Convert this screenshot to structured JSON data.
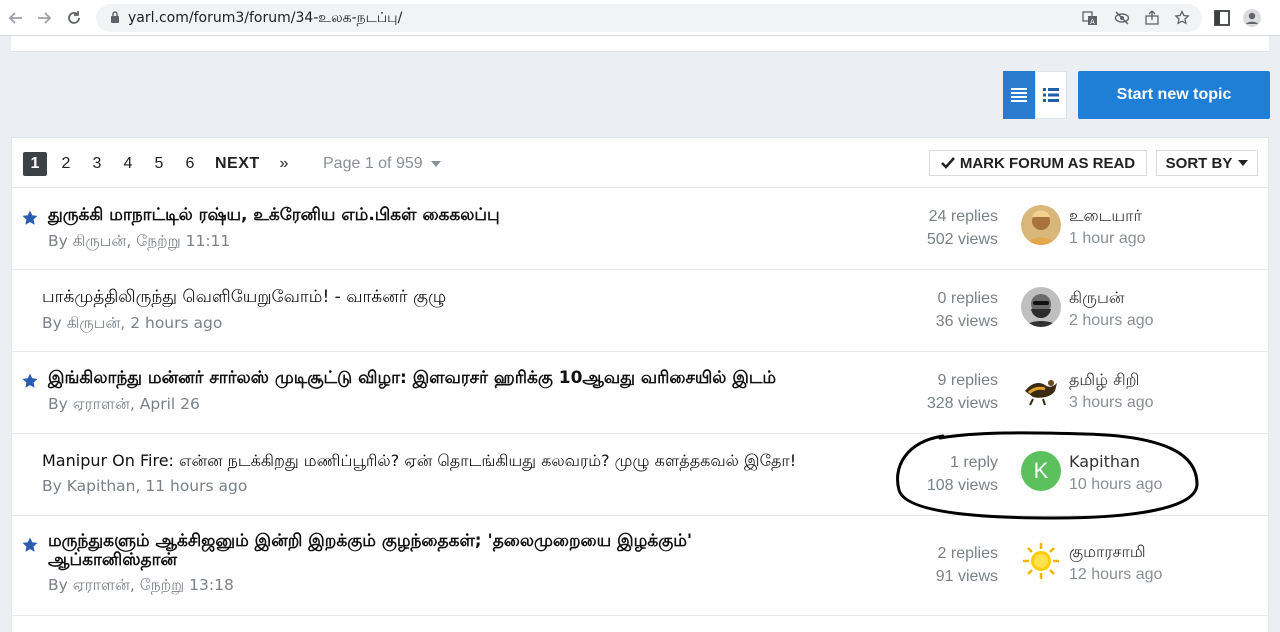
{
  "browser": {
    "url": "yarl.com/forum3/forum/34-உலக-நடப்பு/"
  },
  "toolbar": {
    "start_topic": "Start new topic"
  },
  "pagination": {
    "pages": [
      "1",
      "2",
      "3",
      "4",
      "5",
      "6"
    ],
    "active_page": "1",
    "next": "NEXT",
    "last": "»",
    "page_of": "Page 1 of 959",
    "mark_read": "MARK FORUM AS READ",
    "sort_by": "SORT BY"
  },
  "topics": [
    {
      "title": "துருக்கி மாநாட்டில் ரஷ்ய, உக்ரேனிய எம்.பிகள் கைகலப்பு",
      "byline": "By கிருபன், நேற்று 11:11",
      "starred": true,
      "replies": "24 replies",
      "views": "502 views",
      "last_poster": "உடையார்",
      "last_time": "1 hour ago",
      "avatar": "portrait-icon"
    },
    {
      "title": "பாக்முத்திலிருந்து வெளியேறுவோம்! - வாக்னர் குழு",
      "byline": "By கிருபன், 2 hours ago",
      "starred": false,
      "replies": "0 replies",
      "views": "36 views",
      "last_poster": "கிருபன்",
      "last_time": "2 hours ago",
      "avatar": "bearded-man-icon"
    },
    {
      "title": "இங்கிலாந்து மன்னர் சார்லஸ் முடிசூட்டு விழா: இளவரசர் ஹரிக்கு 10ஆவது வரிசையில் இடம்",
      "byline": "By ஏராளன், April 26",
      "starred": true,
      "replies": "9 replies",
      "views": "328 views",
      "last_poster": "தமிழ் சிறி",
      "last_time": "3 hours ago",
      "avatar": "animal-icon"
    },
    {
      "title": "Manipur On Fire: என்ன நடக்கிறது மணிப்பூரில்? ஏன் தொடங்கியது கலவரம்? முழு களத்தகவல் இதோ!",
      "byline": "By Kapithan, 11 hours ago",
      "starred": false,
      "replies": "1 reply",
      "views": "108 views",
      "last_poster": "Kapithan",
      "last_time": "10 hours ago",
      "avatar_letter": "K"
    },
    {
      "title_line1": "மருந்துகளும் ஆக்சிஜனும் இன்றி இறக்கும் குழந்தைகள்; 'தலைமுறையை இழக்கும்'",
      "title_line2": "ஆப்கானிஸ்தான்",
      "byline": "By ஏராளன், நேற்று 13:18",
      "starred": true,
      "replies": "2 replies",
      "views": "91 views",
      "last_poster": "குமாரசாமி",
      "last_time": "12 hours ago",
      "avatar": "sun-icon"
    }
  ],
  "colors": {
    "accent": "#1f7fd6",
    "star": "#2a5db0",
    "green_avatar": "#5cc05c",
    "annotation": "#000000"
  }
}
